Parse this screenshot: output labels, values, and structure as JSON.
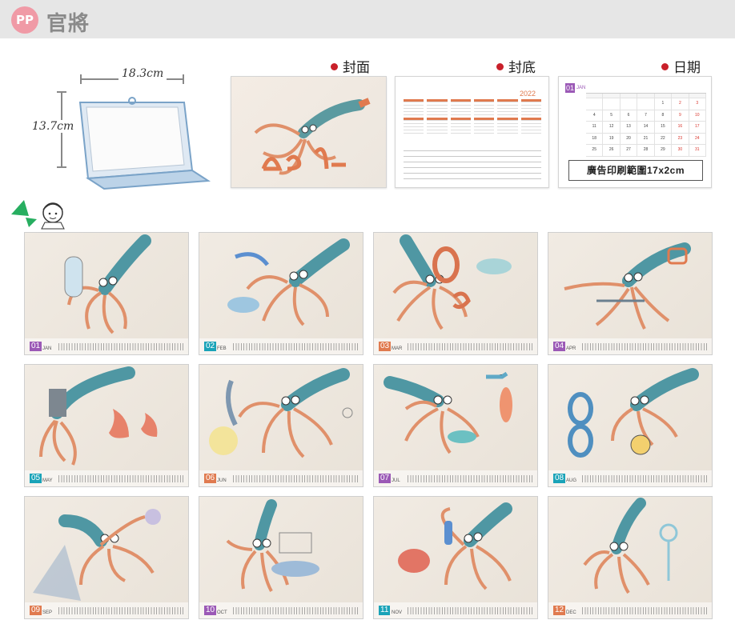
{
  "brand": {
    "logo": "PP",
    "name": "官將"
  },
  "product": {
    "width": "18.3cm",
    "height": "13.7cm"
  },
  "previews": {
    "cover_label": "封面",
    "back_label": "封底",
    "date_label": "日期",
    "back_year": "2022",
    "date_month_num": "01",
    "date_month_name": "JAN",
    "ad_area": "廣告印刷範圍17x2cm"
  },
  "colors": {
    "accent_red": "#c9202a",
    "orange": "#e07a4f"
  },
  "months": [
    {
      "num": "01",
      "name": "JAN",
      "color": "#9b59b6"
    },
    {
      "num": "02",
      "name": "FEB",
      "color": "#1aa3b8"
    },
    {
      "num": "03",
      "name": "MAR",
      "color": "#e07a4f"
    },
    {
      "num": "04",
      "name": "APR",
      "color": "#9b59b6"
    },
    {
      "num": "05",
      "name": "MAY",
      "color": "#1aa3b8"
    },
    {
      "num": "06",
      "name": "JUN",
      "color": "#e07a4f"
    },
    {
      "num": "07",
      "name": "JUL",
      "color": "#9b59b6"
    },
    {
      "num": "08",
      "name": "AUG",
      "color": "#1aa3b8"
    },
    {
      "num": "09",
      "name": "SEP",
      "color": "#e07a4f"
    },
    {
      "num": "10",
      "name": "OCT",
      "color": "#9b59b6"
    },
    {
      "num": "11",
      "name": "NOV",
      "color": "#1aa3b8"
    },
    {
      "num": "12",
      "name": "DEC",
      "color": "#e07a4f"
    }
  ]
}
